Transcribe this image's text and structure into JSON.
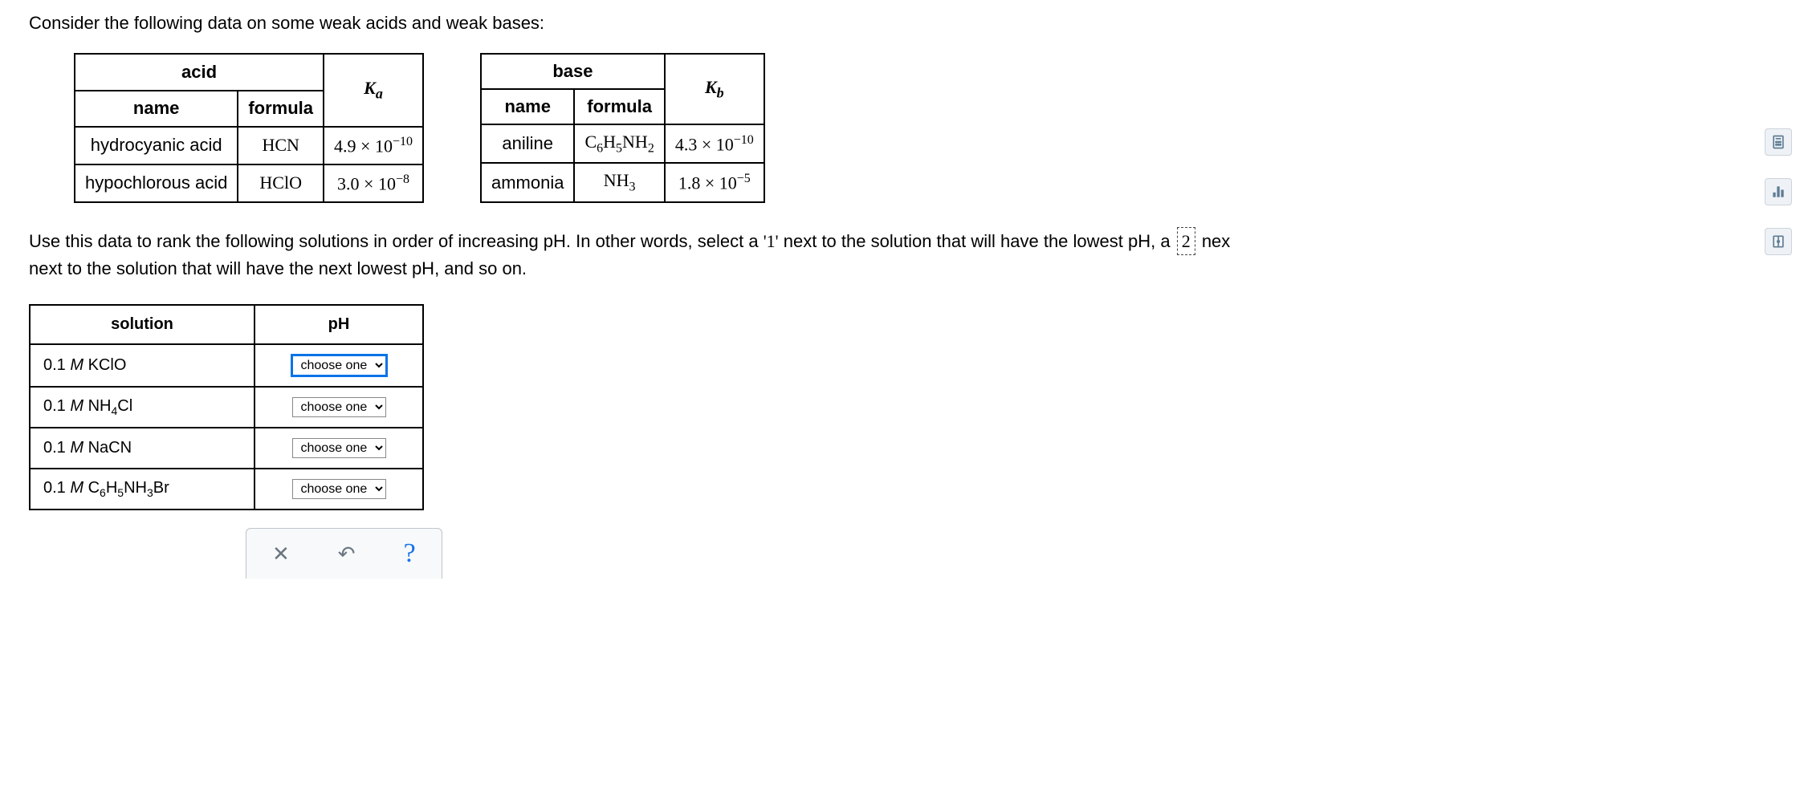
{
  "intro": "Consider the following data on some weak acids and weak bases:",
  "acid_table": {
    "group_header": "acid",
    "name_header": "name",
    "formula_header": "formula",
    "k_label_html": "K<sub>a</sub>",
    "rows": [
      {
        "name": "hydrocyanic acid",
        "formula_html": "HCN",
        "value_html": "4.9 × 10<sup>−10</sup>"
      },
      {
        "name": "hypochlorous acid",
        "formula_html": "HClO",
        "value_html": "3.0 × 10<sup>−8</sup>"
      }
    ]
  },
  "base_table": {
    "group_header": "base",
    "name_header": "name",
    "formula_header": "formula",
    "k_label_html": "K<sub>b</sub>",
    "rows": [
      {
        "name": "aniline",
        "formula_html": "C<sub>6</sub>H<sub>5</sub>NH<sub>2</sub>",
        "value_html": "4.3 × 10<sup>−10</sup>"
      },
      {
        "name": "ammonia",
        "formula_html": "NH<sub>3</sub>",
        "value_html": "1.8 × 10<sup>−5</sup>"
      }
    ]
  },
  "instruction_prefix": "Use this data to rank the following solutions in order of increasing pH. In other words, select a ",
  "rank_one": "'1'",
  "instruction_mid": " next to the solution that will have the lowest pH, a ",
  "rank_two": "2",
  "instruction_suffix": " next to the solution that will have the next lowest pH, and so on.",
  "solution_table": {
    "solution_header": "solution",
    "ph_header": "pH",
    "placeholder": "choose one",
    "rows": [
      {
        "label_html": "0.1 <span class='italic-M'>M</span> KClO"
      },
      {
        "label_html": "0.1 <span class='italic-M'>M</span> <span class='formula-inline'>NH<sub>4</sub>Cl</span>"
      },
      {
        "label_html": "0.1 <span class='italic-M'>M</span> NaCN"
      },
      {
        "label_html": "0.1 <span class='italic-M'>M</span> <span class='formula-inline'>C<sub>6</sub>H<sub>5</sub>NH<sub>3</sub>Br</span>"
      }
    ]
  },
  "controls": {
    "clear_title": "Clear",
    "undo_title": "Undo",
    "help_title": "Help"
  },
  "side": {
    "calculator": "Calculator",
    "periodic": "Periodic Table",
    "reference": "Reference"
  }
}
